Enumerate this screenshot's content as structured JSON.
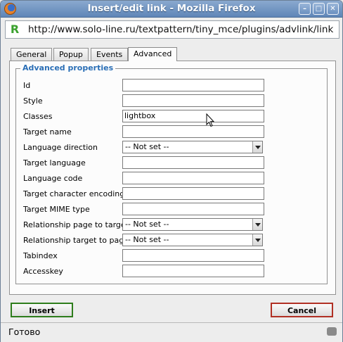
{
  "window": {
    "title": "Insert/edit link - Mozilla Firefox",
    "minimize_glyph": "–",
    "maximize_glyph": "□",
    "close_glyph": "✕"
  },
  "urlbar": {
    "site_icon_glyph": "R",
    "url": "http://www.solo-line.ru/textpattern/tiny_mce/plugins/advlink/link"
  },
  "tabs": [
    {
      "label": "General",
      "active": false
    },
    {
      "label": "Popup",
      "active": false
    },
    {
      "label": "Events",
      "active": false
    },
    {
      "label": "Advanced",
      "active": true
    }
  ],
  "fieldset": {
    "legend": "Advanced properties",
    "fields": [
      {
        "label": "Id",
        "type": "text",
        "value": ""
      },
      {
        "label": "Style",
        "type": "text",
        "value": ""
      },
      {
        "label": "Classes",
        "type": "text",
        "value": "lightbox"
      },
      {
        "label": "Target name",
        "type": "text",
        "value": ""
      },
      {
        "label": "Language direction",
        "type": "select",
        "value": "-- Not set --"
      },
      {
        "label": "Target language",
        "type": "text",
        "value": ""
      },
      {
        "label": "Language code",
        "type": "text",
        "value": ""
      },
      {
        "label": "Target character encoding",
        "type": "text",
        "value": ""
      },
      {
        "label": "Target MIME type",
        "type": "text",
        "value": ""
      },
      {
        "label": "Relationship page to target",
        "type": "select",
        "value": "-- Not set --"
      },
      {
        "label": "Relationship target to page",
        "type": "select",
        "value": "-- Not set --"
      },
      {
        "label": "Tabindex",
        "type": "text",
        "value": ""
      },
      {
        "label": "Accesskey",
        "type": "text",
        "value": ""
      }
    ]
  },
  "buttons": {
    "insert": "Insert",
    "cancel": "Cancel"
  },
  "statusbar": {
    "text": "Готово"
  },
  "colors": {
    "titlebar": "#6d93c4",
    "legend": "#2b6fb6",
    "insert_border": "#2e7d1c",
    "cancel_border": "#b13024"
  }
}
